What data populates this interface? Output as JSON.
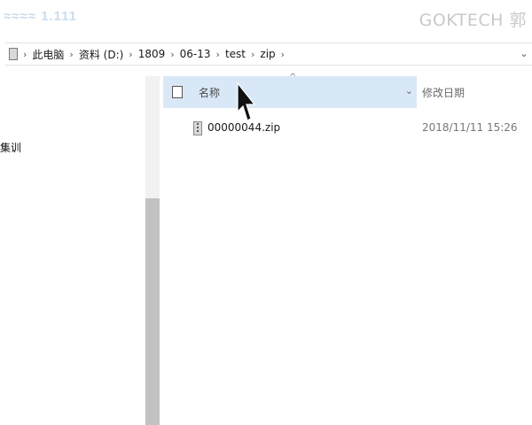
{
  "watermark": {
    "logo_text": "≈≈≈≈ 1.111",
    "brand_text": "GOKTECH 郭"
  },
  "address_bar": {
    "crumbs": [
      "此电脑",
      "资料 (D:)",
      "1809",
      "06-13",
      "test",
      "zip"
    ],
    "separator": "›",
    "dropdown": "⌄"
  },
  "nav_pane": {
    "partial_label": "集训"
  },
  "columns": {
    "name": "名称",
    "date_modified": "修改日期",
    "sort_indicator": "^",
    "chevron": "⌄"
  },
  "files": [
    {
      "name": "00000044.zip",
      "modified": "2018/11/11 15:26",
      "icon": "zip-file-icon"
    }
  ],
  "colors": {
    "header_highlight": "#d9e8f7",
    "scrollbar_thumb": "#c2c2c2"
  }
}
